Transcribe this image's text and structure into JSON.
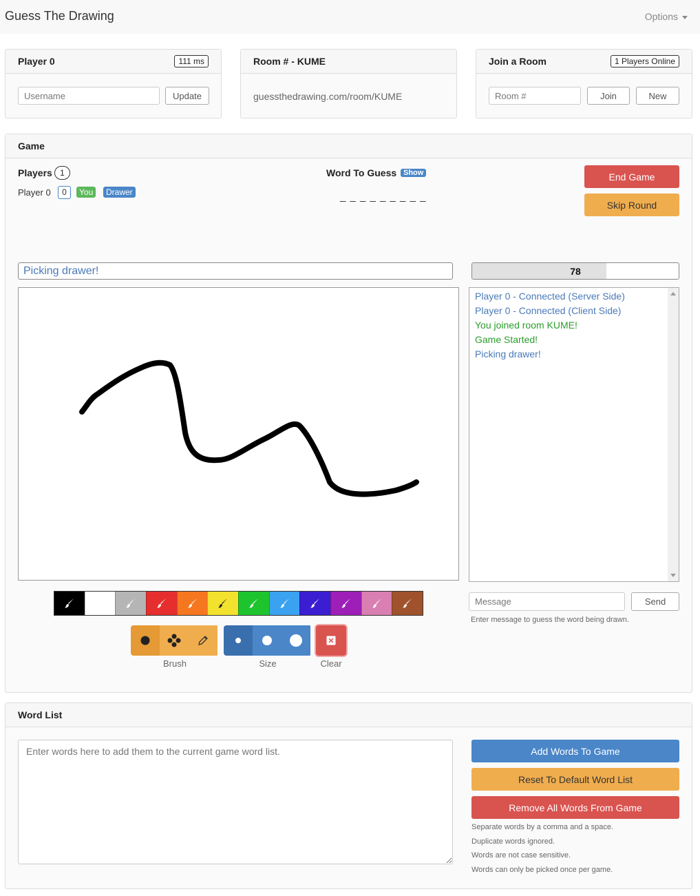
{
  "app": {
    "title": "Guess The Drawing",
    "options_label": "Options"
  },
  "player_panel": {
    "title": "Player 0",
    "ping": "111 ms",
    "username_placeholder": "Username",
    "update_label": "Update"
  },
  "room_panel": {
    "title": "Room # - KUME",
    "url": "guessthedrawing.com/room/KUME"
  },
  "join_panel": {
    "title": "Join a Room",
    "online": "1 Players Online",
    "room_placeholder": "Room #",
    "join_label": "Join",
    "new_label": "New"
  },
  "game": {
    "title": "Game",
    "players_label": "Players",
    "players_count": "1",
    "player": {
      "name": "Player 0",
      "score": "0",
      "you_label": "You",
      "drawer_label": "Drawer"
    },
    "word_label": "Word To Guess",
    "show_label": "Show",
    "word_blanks": "_ _ _ _ _ _ _ _ _",
    "end_game_label": "End Game",
    "skip_round_label": "Skip Round",
    "status": "Picking drawer!",
    "timer": "78",
    "timer_progress": 0.65
  },
  "chat": {
    "lines": [
      {
        "text": "Player 0 - Connected (Server Side)",
        "color": "#4a7ab8"
      },
      {
        "text": "Player 0 - Connected (Client Side)",
        "color": "#4a7ab8"
      },
      {
        "text": "You joined room KUME!",
        "color": "#2a9d2a"
      },
      {
        "text": "Game Started!",
        "color": "#2a9d2a"
      },
      {
        "text": "Picking drawer!",
        "color": "#4a7ab8"
      }
    ],
    "message_placeholder": "Message",
    "send_label": "Send",
    "help": "Enter message to guess the word being drawn."
  },
  "palette": [
    "#000000",
    "#ffffff",
    "#b5b5b5",
    "#e62e2e",
    "#f5771f",
    "#f2e22e",
    "#1ec42e",
    "#3aa2f0",
    "#3b1ed1",
    "#9e1eb8",
    "#d97fb2",
    "#a0522d"
  ],
  "tools": {
    "brush_caption": "Brush",
    "size_caption": "Size",
    "clear_caption": "Clear",
    "brush_icons": [
      "circle-brush-icon",
      "diamond-brush-icon",
      "pencil-icon"
    ],
    "size_icons": [
      "small-dot-icon",
      "medium-dot-icon",
      "large-dot-icon"
    ]
  },
  "word_list": {
    "title": "Word List",
    "placeholder": "Enter words here to add them to the current game word list.",
    "add_label": "Add Words To Game",
    "reset_label": "Reset To Default Word List",
    "remove_label": "Remove All Words From Game",
    "help": [
      "Separate words by a comma and a space.",
      "Duplicate words ignored.",
      "Words are not case sensitive.",
      "Words can only be picked once per game."
    ]
  }
}
